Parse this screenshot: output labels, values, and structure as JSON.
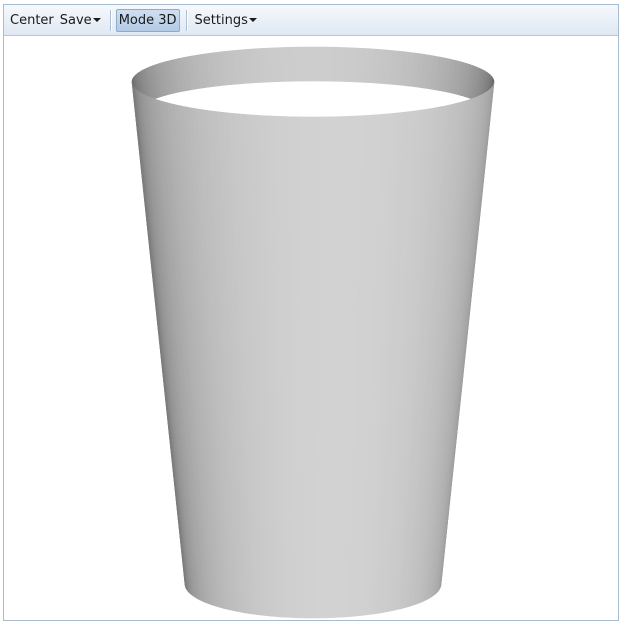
{
  "toolbar": {
    "center_label": "Center",
    "save_label": "Save",
    "mode_label": "Mode 3D",
    "settings_label": "Settings"
  },
  "viewer": {
    "object": "cylinder-surface",
    "fill_color": "#c8c8c8",
    "background": "#ffffff"
  }
}
